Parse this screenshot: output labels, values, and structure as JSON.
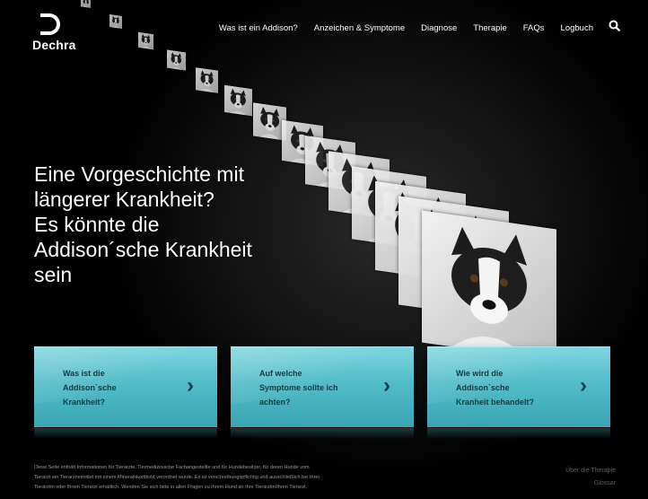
{
  "brand": {
    "name": "Dechra"
  },
  "nav": {
    "items": [
      {
        "label": "Was ist ein Addison?"
      },
      {
        "label": "Anzeichen & Symptome"
      },
      {
        "label": "Diagnose"
      },
      {
        "label": "Therapie"
      },
      {
        "label": "FAQs"
      },
      {
        "label": "Logbuch"
      }
    ],
    "search_icon": "search-icon"
  },
  "hero": {
    "lines": [
      "Eine Vorgeschichte mit",
      "längerer Krankheit?",
      "Es könnte die",
      "Addison´sche Krankheit",
      "sein"
    ]
  },
  "tiles": [
    {
      "lines": [
        "Was ist die",
        "Addison`sche",
        "Krankheit?"
      ],
      "arrow": "›"
    },
    {
      "lines": [
        "Auf welche",
        "Symptome sollte ich",
        "achten?"
      ],
      "arrow": "›"
    },
    {
      "lines": [
        "Wie wird die",
        "Addison`sche",
        "Kranheit behandelt?"
      ],
      "arrow": "›"
    }
  ],
  "footer": {
    "lines": [
      "Diese Seite enthält Informationen für Tierärzte, Tiermedizinische Fachangestellte und für Hundebesitzer, für deren Hunde vom",
      "Tierarzt ein Tierarzneimittel mit einem Mineralokortikoid verordnet wurde. Es ist verschreibungspflichtig und ausschließlich bei Ihrer",
      "Tierärztin oder Ihrem Tierarzt erhältlich. Wenden Sie sich bitte in allen Fragen zu Ihrem Hund an Ihre Tierärztin/Ihren Tierarzt."
    ],
    "links": [
      "Über die Therapie",
      "Glossar"
    ]
  },
  "colors": {
    "accent": "#52bcc9",
    "tile_text": "#0f3c44",
    "background": "#000000"
  }
}
